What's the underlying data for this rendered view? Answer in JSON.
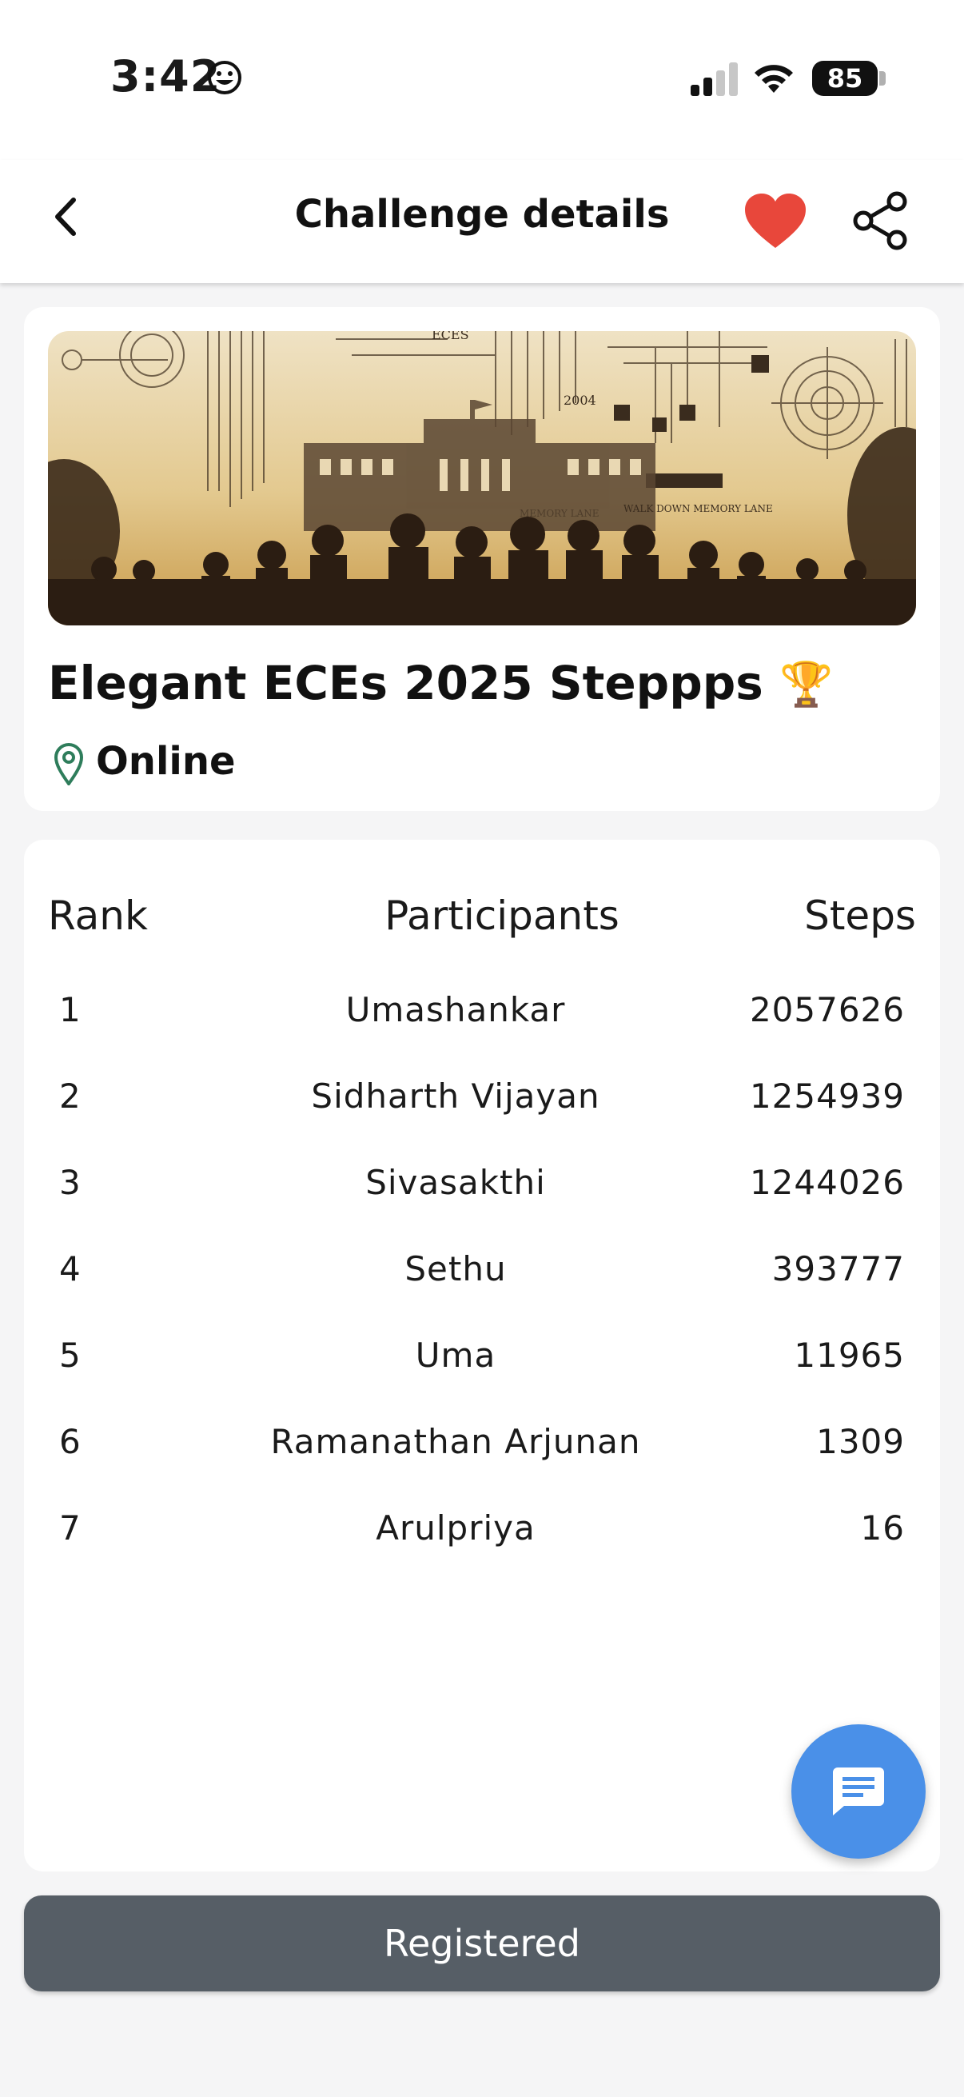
{
  "status_bar": {
    "time": "3:42",
    "battery": "85",
    "time_emoji_icon": "smiley-face-icon"
  },
  "header": {
    "title": "Challenge details",
    "back_icon": "chevron-left-icon",
    "favorite_icon": "heart-icon",
    "share_icon": "share-icon"
  },
  "challenge": {
    "title": "Elegant ECEs 2025 Steppps",
    "title_emoji": "🏆",
    "location_icon": "map-pin-icon",
    "location": "Online",
    "banner": {
      "text_top": "ECES",
      "text_year": "2004",
      "text_lane": "WALK DOWN MEMORY LANE",
      "text_lane_small": "MEMORY LANE"
    }
  },
  "leaderboard": {
    "headers": {
      "rank": "Rank",
      "participants": "Participants",
      "steps": "Steps"
    },
    "rows": [
      {
        "rank": "1",
        "name": "Umashankar",
        "steps": "2057626"
      },
      {
        "rank": "2",
        "name": "Sidharth Vijayan",
        "steps": "1254939"
      },
      {
        "rank": "3",
        "name": "Sivasakthi",
        "steps": "1244026"
      },
      {
        "rank": "4",
        "name": "Sethu",
        "steps": "393777"
      },
      {
        "rank": "5",
        "name": "Uma",
        "steps": "11965"
      },
      {
        "rank": "6",
        "name": "Ramanathan Arjunan",
        "steps": "1309"
      },
      {
        "rank": "7",
        "name": "Arulpriya",
        "steps": "16"
      }
    ]
  },
  "fab": {
    "icon": "chat-message-icon"
  },
  "action": {
    "label": "Registered"
  },
  "colors": {
    "heart": "#e8473b",
    "pin": "#2e7d5b",
    "fab": "#4a90e8",
    "button": "#565e66"
  }
}
